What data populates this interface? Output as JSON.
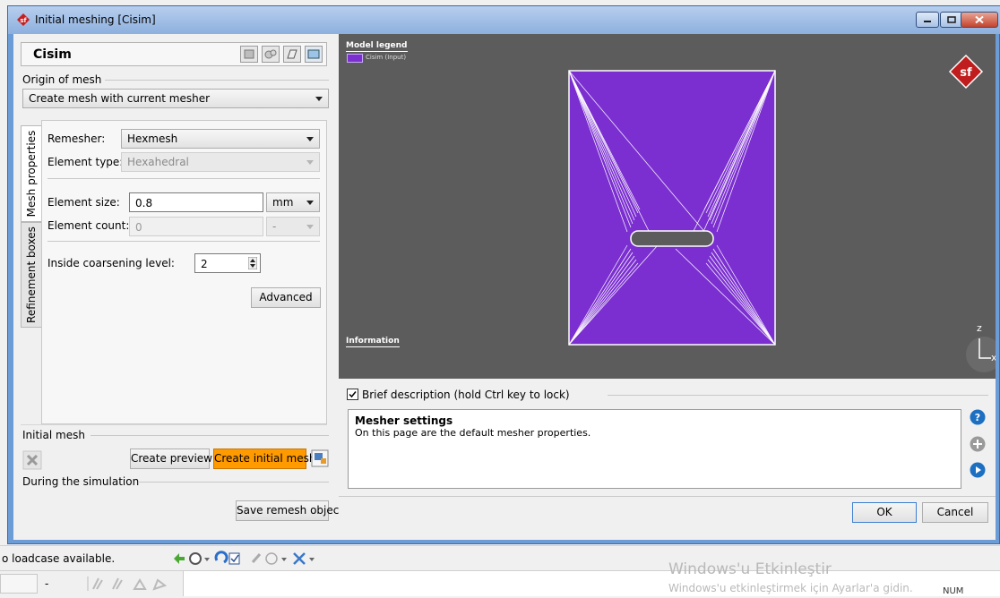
{
  "window": {
    "title": "Initial meshing [Cisim]"
  },
  "object": {
    "name": "Cisim"
  },
  "origin": {
    "section_label": "Origin of mesh",
    "value": "Create mesh with current mesher"
  },
  "tabs": [
    {
      "label": "Mesh properties",
      "active": true
    },
    {
      "label": "Refinement boxes",
      "active": false
    }
  ],
  "mesh": {
    "remesher_label": "Remesher:",
    "remesher_value": "Hexmesh",
    "element_type_label": "Element type:",
    "element_type_value": "Hexahedral",
    "element_size_label": "Element size:",
    "element_size_value": "0.8",
    "element_size_unit": "mm",
    "element_count_label": "Element count:",
    "element_count_value": "0",
    "element_count_unit": "-",
    "coarsening_label": "Inside coarsening level:",
    "coarsening_value": "2",
    "advanced_label": "Advanced"
  },
  "initial_mesh": {
    "section_label": "Initial mesh",
    "preview_label": "Create preview",
    "create_label": "Create initial mesh"
  },
  "simulation": {
    "section_label": "During the simulation",
    "save_label": "Save remesh object"
  },
  "viewport": {
    "legend_title": "Model legend",
    "legend_item": "Cisim (Input)",
    "legend_color": "#7b2fd0",
    "info_label": "Information",
    "axis_z": "z",
    "axis_x": "x",
    "logo_text": "sf"
  },
  "description": {
    "checkbox_label": "Brief description (hold Ctrl key to lock)",
    "checked": true,
    "heading": "Mesher settings",
    "body": "On this page are the default mesher properties."
  },
  "dialog_buttons": {
    "ok": "OK",
    "cancel": "Cancel"
  },
  "status": {
    "loadcase_text": "o loadcase available.",
    "field2_text": "-",
    "num": "NUM"
  },
  "activation": {
    "title": "Windows'u Etkinleştir",
    "subtitle": "Windows'u etkinleştirmek için Ayarlar'a gidin."
  }
}
